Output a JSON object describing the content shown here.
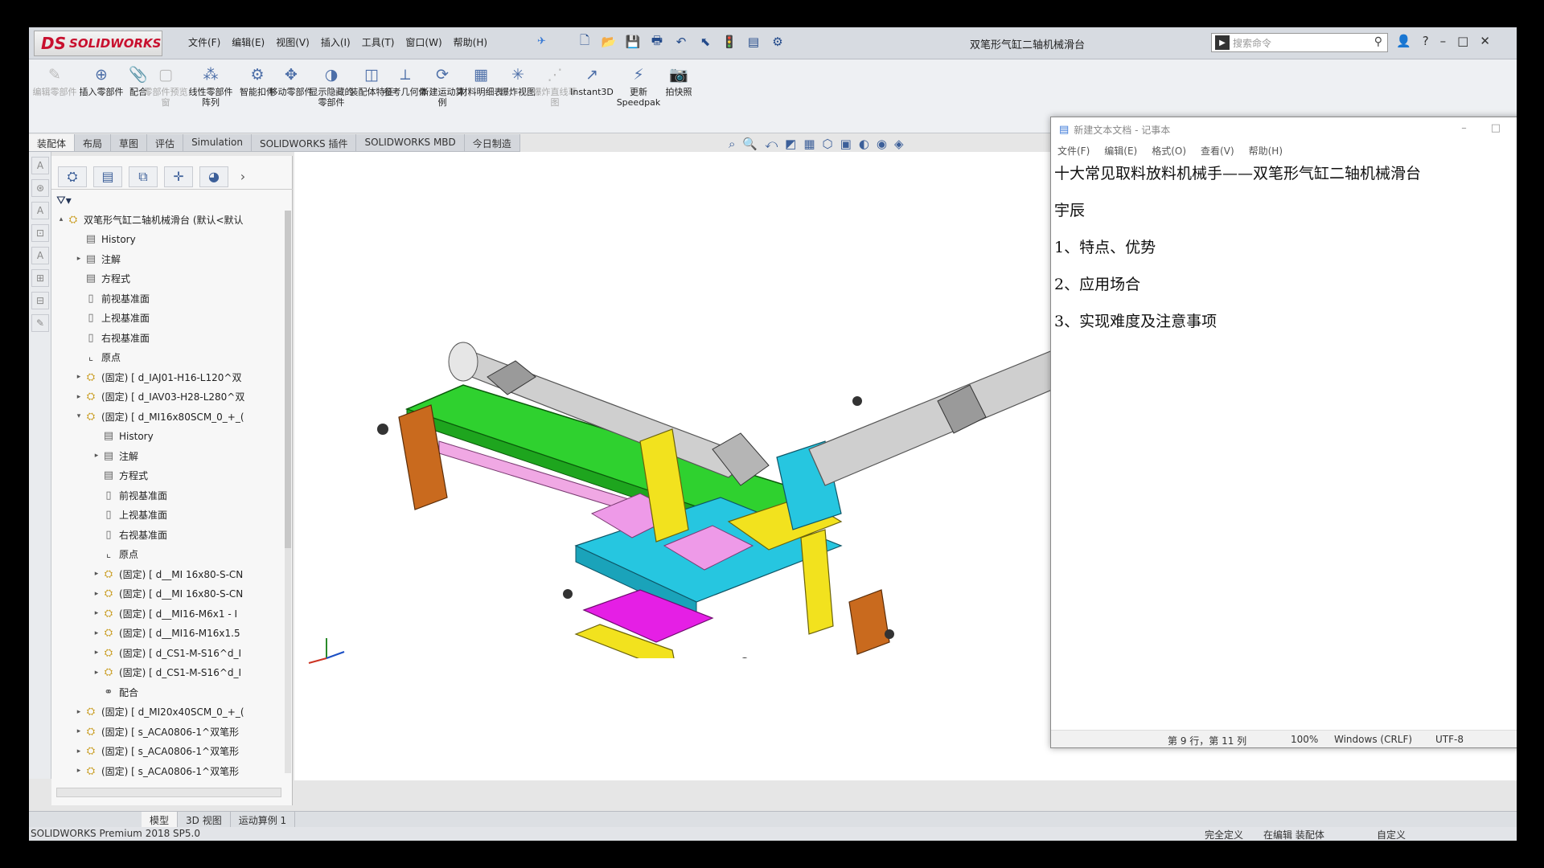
{
  "app": {
    "logo_ds": "DS",
    "logo_text": "SOLIDWORKS",
    "title": "双笔形气缸二轴机械滑台",
    "search_placeholder": "搜索命令"
  },
  "menu": [
    "文件(F)",
    "编辑(E)",
    "视图(V)",
    "插入(I)",
    "工具(T)",
    "窗口(W)",
    "帮助(H)"
  ],
  "ribbon": [
    {
      "label": "编辑零部件",
      "icon": "edit-component-icon",
      "disabled": true
    },
    {
      "label": "插入零部件",
      "icon": "insert-component-icon",
      "disabled": false
    },
    {
      "label": "配合",
      "icon": "mate-icon",
      "disabled": false
    },
    {
      "label": "零部件预览窗",
      "icon": "component-preview-icon",
      "disabled": true
    },
    {
      "label": "线性零部件阵列",
      "icon": "linear-pattern-icon",
      "disabled": false
    },
    {
      "label": "智能扣件",
      "icon": "smart-fasteners-icon",
      "disabled": false
    },
    {
      "label": "移动零部件",
      "icon": "move-component-icon",
      "disabled": false
    },
    {
      "label": "显示隐藏的零部件",
      "icon": "show-hidden-icon",
      "disabled": false
    },
    {
      "label": "装配体特征",
      "icon": "assembly-feature-icon",
      "disabled": false
    },
    {
      "label": "参考几何体",
      "icon": "reference-geometry-icon",
      "disabled": false
    },
    {
      "label": "新建运动算例",
      "icon": "motion-study-icon",
      "disabled": false
    },
    {
      "label": "材料明细表",
      "icon": "bom-icon",
      "disabled": false
    },
    {
      "label": "爆炸视图",
      "icon": "exploded-view-icon",
      "disabled": false
    },
    {
      "label": "爆炸直线草图",
      "icon": "explode-line-sketch-icon",
      "disabled": true
    },
    {
      "label": "Instant3D",
      "icon": "instant3d-icon",
      "disabled": false
    },
    {
      "label": "更新Speedpak",
      "icon": "speedpak-icon",
      "disabled": false
    },
    {
      "label": "拍快照",
      "icon": "snapshot-icon",
      "disabled": false
    }
  ],
  "tabs": [
    "装配体",
    "布局",
    "草图",
    "评估",
    "Simulation",
    "SOLIDWORKS 插件",
    "SOLIDWORKS MBD",
    "今日制造"
  ],
  "tree": [
    {
      "level": 0,
      "expand": "up",
      "icon": "asm",
      "label": "双笔形气缸二轴机械滑台 (默认<默认"
    },
    {
      "level": 1,
      "expand": "",
      "icon": "doc",
      "label": "History"
    },
    {
      "level": 1,
      "expand": "right",
      "icon": "doc",
      "label": "注解"
    },
    {
      "level": 1,
      "expand": "",
      "icon": "doc",
      "label": "方程式"
    },
    {
      "level": 1,
      "expand": "",
      "icon": "plane",
      "label": "前视基准面"
    },
    {
      "level": 1,
      "expand": "",
      "icon": "plane",
      "label": "上视基准面"
    },
    {
      "level": 1,
      "expand": "",
      "icon": "plane",
      "label": "右视基准面"
    },
    {
      "level": 1,
      "expand": "",
      "icon": "orig",
      "label": "原点"
    },
    {
      "level": 1,
      "expand": "right",
      "icon": "asm",
      "label": "(固定) [ d_IAJ01-H16-L120^双"
    },
    {
      "level": 1,
      "expand": "right",
      "icon": "asm",
      "label": "(固定) [ d_IAV03-H28-L280^双"
    },
    {
      "level": 1,
      "expand": "down",
      "icon": "asm",
      "label": "(固定) [ d_MI16x80SCM_0_+_("
    },
    {
      "level": 2,
      "expand": "",
      "icon": "doc",
      "label": "History"
    },
    {
      "level": 2,
      "expand": "right",
      "icon": "doc",
      "label": "注解"
    },
    {
      "level": 2,
      "expand": "",
      "icon": "doc",
      "label": "方程式"
    },
    {
      "level": 2,
      "expand": "",
      "icon": "plane",
      "label": "前视基准面"
    },
    {
      "level": 2,
      "expand": "",
      "icon": "plane",
      "label": "上视基准面"
    },
    {
      "level": 2,
      "expand": "",
      "icon": "plane",
      "label": "右视基准面"
    },
    {
      "level": 2,
      "expand": "",
      "icon": "orig",
      "label": "原点"
    },
    {
      "level": 2,
      "expand": "right",
      "icon": "asm",
      "label": "(固定) [ d__MI 16x80-S-CN"
    },
    {
      "level": 2,
      "expand": "right",
      "icon": "asm",
      "label": "(固定) [ d__MI 16x80-S-CN"
    },
    {
      "level": 2,
      "expand": "right",
      "icon": "asm",
      "label": "(固定) [ d__MI16-M6x1 - I"
    },
    {
      "level": 2,
      "expand": "right",
      "icon": "asm",
      "label": "(固定) [ d__MI16-M16x1.5"
    },
    {
      "level": 2,
      "expand": "right",
      "icon": "asm",
      "label": "(固定) [ d_CS1-M-S16^d_I"
    },
    {
      "level": 2,
      "expand": "right",
      "icon": "asm",
      "label": "(固定) [ d_CS1-M-S16^d_I"
    },
    {
      "level": 2,
      "expand": "",
      "icon": "mate",
      "label": "配合"
    },
    {
      "level": 1,
      "expand": "right",
      "icon": "asm",
      "label": "(固定) [ d_MI20x40SCM_0_+_("
    },
    {
      "level": 1,
      "expand": "right",
      "icon": "asm",
      "label": "(固定) [ s_ACA0806-1^双笔形"
    },
    {
      "level": 1,
      "expand": "right",
      "icon": "asm",
      "label": "(固定) [ s_ACA0806-1^双笔形"
    },
    {
      "level": 1,
      "expand": "right",
      "icon": "asm",
      "label": "(固定) [ s_ACA0806-1^双笔形"
    }
  ],
  "bottom_tabs": [
    "模型",
    "3D 视图",
    "运动算例 1"
  ],
  "status": {
    "version": "SOLIDWORKS Premium 2018 SP5.0",
    "defined": "完全定义",
    "editing": "在编辑 装配体",
    "custom": "自定义"
  },
  "notepad": {
    "title": "新建文本文档 - 记事本",
    "menu": [
      "文件(F)",
      "编辑(E)",
      "格式(O)",
      "查看(V)",
      "帮助(H)"
    ],
    "lines": [
      "十大常见取料放料机械手——双笔形气缸二轴机械滑台",
      "宇辰",
      "1、特点、优势",
      "2、应用场合",
      "3、实现难度及注意事项"
    ],
    "status_pos": "第 9 行，第 11 列",
    "status_zoom": "100%",
    "status_eol": "Windows (CRLF)",
    "status_enc": "UTF-8"
  },
  "colors": {
    "green_plate": "#2fd12f",
    "cyan_block": "#26c6e0",
    "yellow_part": "#f2e21e",
    "magenta_part": "#e51fe5",
    "pink_part": "#ee9ae8",
    "orange_part": "#c96a1e",
    "cylinder": "#c9c9c9"
  }
}
